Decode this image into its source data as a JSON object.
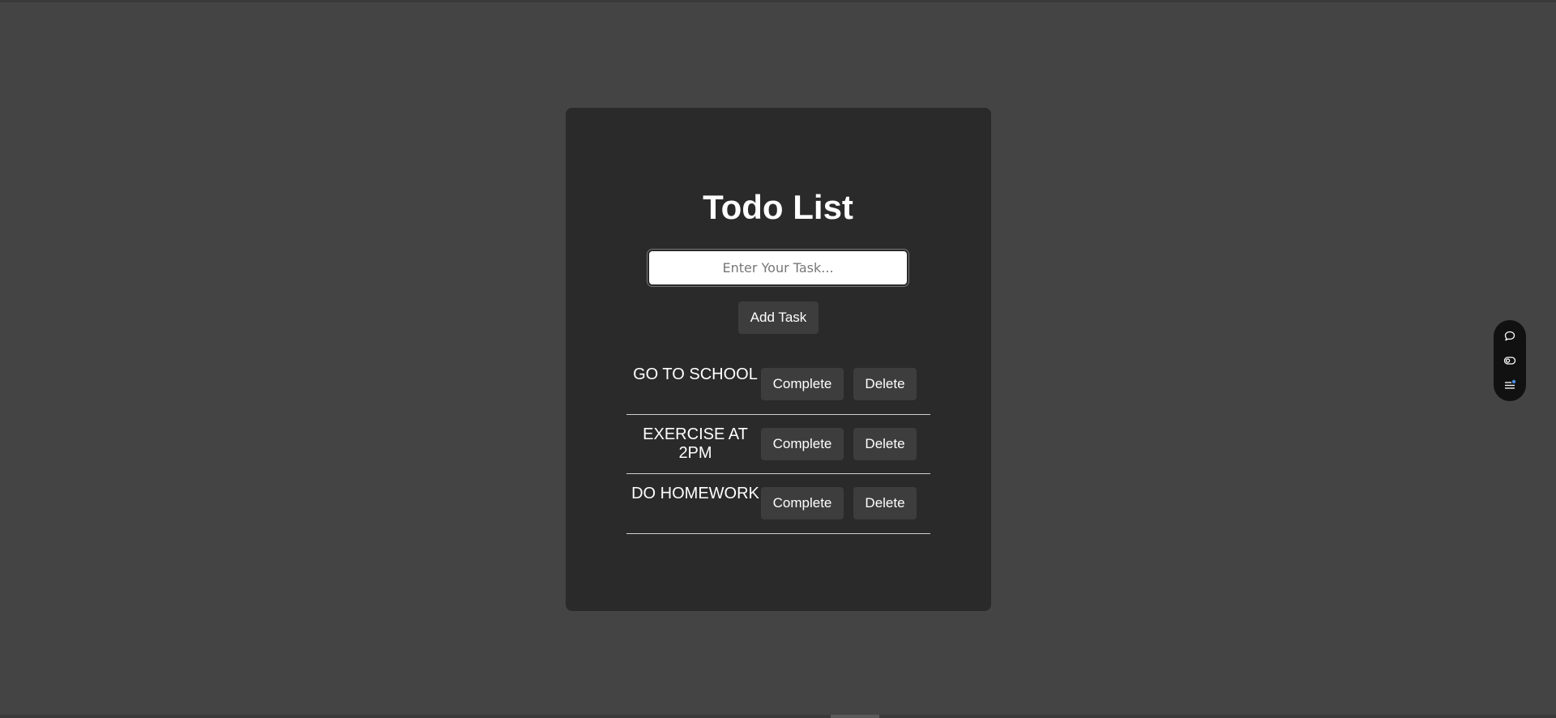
{
  "app": {
    "title": "Todo List",
    "input_placeholder": "Enter Your Task...",
    "add_button_label": "Add Task"
  },
  "tasks": [
    {
      "name": "GO TO SCHOOL",
      "complete_label": "Complete",
      "delete_label": "Delete"
    },
    {
      "name": "EXERCISE AT 2PM",
      "complete_label": "Complete",
      "delete_label": "Delete"
    },
    {
      "name": "DO HOMEWORK",
      "complete_label": "Complete",
      "delete_label": "Delete"
    }
  ],
  "floating_toolbar": {
    "icons": [
      "chat-bubble-icon",
      "toggle-icon",
      "list-menu-icon"
    ]
  },
  "colors": {
    "page_background": "#444444",
    "card_background": "#2a2a2a",
    "button_background": "#3d3d3d",
    "text": "#ffffff",
    "accent_dot": "#4a90e2"
  }
}
